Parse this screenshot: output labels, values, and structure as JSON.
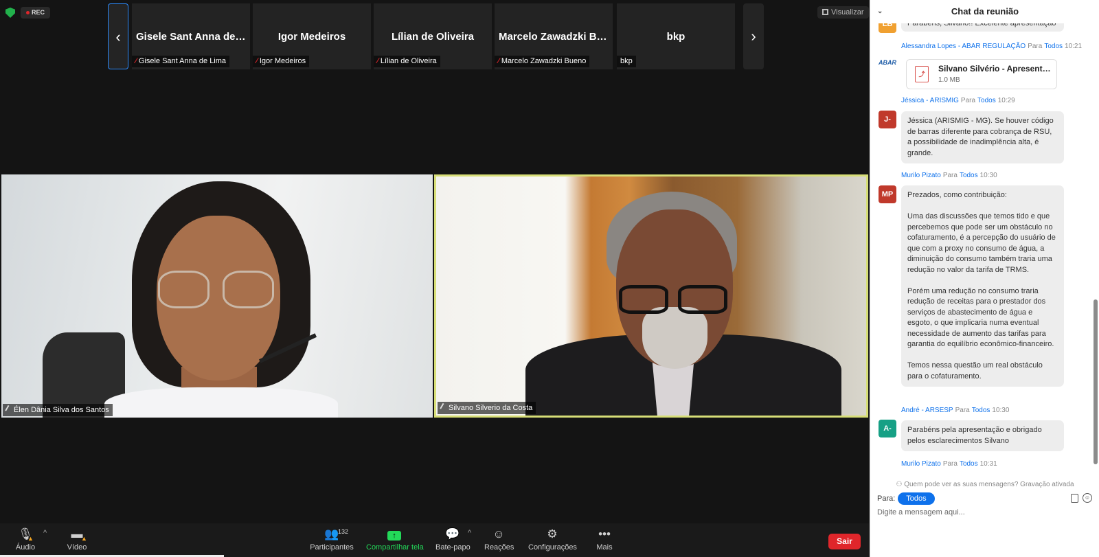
{
  "top": {
    "rec": "REC",
    "view": "Visualizar"
  },
  "thumbnails": [
    {
      "name": "Gisele Sant Anna de Li...",
      "label": "Gisele Sant Anna de Lima"
    },
    {
      "name": "Igor Medeiros",
      "label": "Igor Medeiros"
    },
    {
      "name": "Lílian de Oliveira",
      "label": "Lílian de Oliveira"
    },
    {
      "name": "Marcelo Zawadzki Bue...",
      "label": "Marcelo Zawadzki Bueno"
    },
    {
      "name": "bkp",
      "label": "bkp"
    }
  ],
  "videos": {
    "left": {
      "label": "Élen Dânia Silva dos Santos"
    },
    "right": {
      "label": "Silvano Silverio da Costa"
    }
  },
  "toolbar": {
    "audio": "Áudio",
    "video": "Vídeo",
    "participants": "Participantes",
    "participants_count": "132",
    "share": "Compartilhar tela",
    "chat": "Bate-papo",
    "reactions": "Reações",
    "settings": "Configurações",
    "more": "Mais",
    "leave": "Sair"
  },
  "chat": {
    "title": "Chat da reunião",
    "top_partial": "Parabéns, Silvano!! Excelente apresentação",
    "top_avatar": "LB",
    "to_word": "Para",
    "all_word": "Todos",
    "messages": [
      {
        "sender": "Alessandra Lopes - ABAR REGULAÇÃO",
        "time": "10:21",
        "logo": "ABAR",
        "file_name": "Silvano Silvério - Apresentação",
        "file_size": "1.0 MB"
      },
      {
        "sender": "Jéssica - ARISMIG",
        "time": "10:29",
        "avatar": "J-",
        "text": "Jéssica (ARISMIG - MG). Se houver código de barras diferente para cobrança de RSU, a possibilidade de inadimplência alta, é grande."
      },
      {
        "sender": "Murilo Pizato",
        "time": "10:30",
        "avatar": "MP",
        "text": "Prezados, como contribuição:\n\nUma das discussões que temos tido e que percebemos que pode ser um obstáculo no cofaturamento, é a percepção do usuário de que com a proxy no consumo de água, a diminuição do consumo também traria uma redução no valor da tarifa de TRMS.\n\nPorém uma redução no consumo traria redução de receitas para o prestador dos serviços de abastecimento de água e esgoto, o que implicaria numa eventual necessidade de aumento das tarifas para garantia do equilíbrio econômico-financeiro.\n\nTemos nessa questão um real obstáculo para o cofaturamento."
      },
      {
        "sender": "André - ARSESP",
        "time": "10:30",
        "avatar": "A-",
        "text": "Parabéns pela apresentação e obrigado pelos esclarecimentos Silvano"
      },
      {
        "sender": "Murilo Pizato",
        "time": "10:31"
      }
    ],
    "privacy": "Quem pode ver as suas mensagens? Gravação ativada",
    "to_label": "Para:",
    "to_value": "Todos",
    "input_placeholder": "Digite a mensagem aqui..."
  },
  "colors": {
    "accent": "#0e71eb",
    "leave": "#e0262b",
    "active_speaker": "#d7de77",
    "share": "#23d959"
  }
}
